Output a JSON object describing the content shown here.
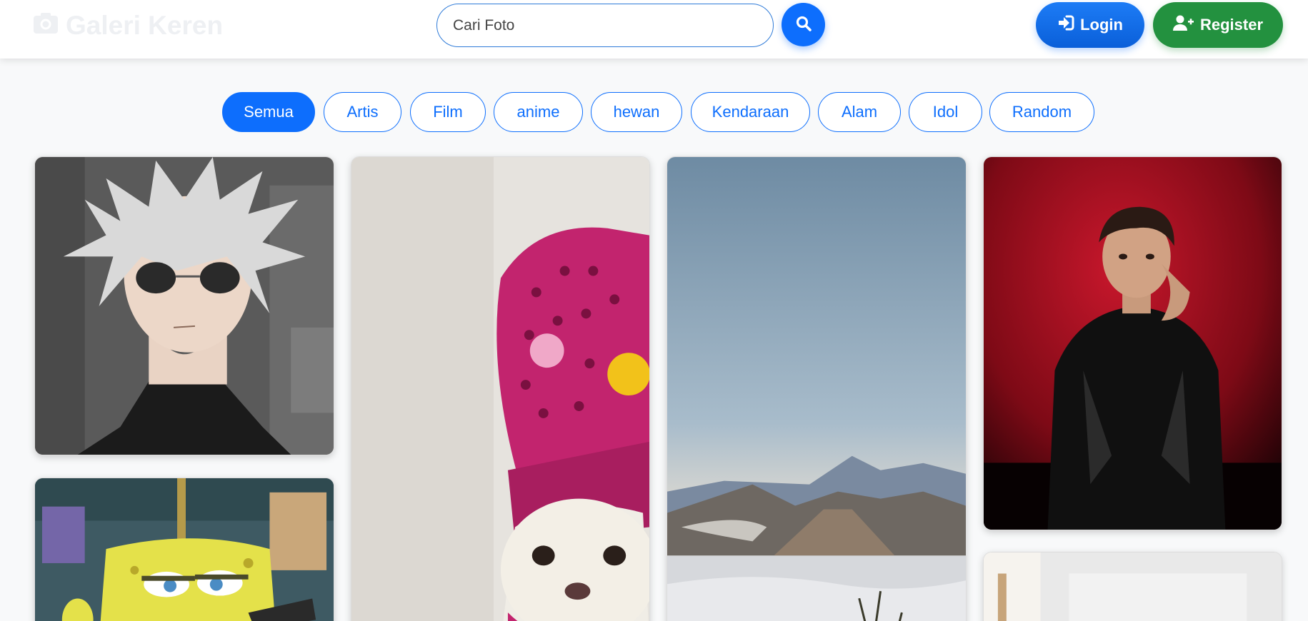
{
  "brand": {
    "title": "Galeri Keren",
    "icon": "camera-icon"
  },
  "search": {
    "placeholder": "Cari Foto",
    "button_icon": "search-icon"
  },
  "auth": {
    "login_label": "Login",
    "login_icon": "sign-in-icon",
    "register_label": "Register",
    "register_icon": "user-plus-icon"
  },
  "categories": [
    {
      "label": "Semua",
      "active": true
    },
    {
      "label": "Artis",
      "active": false
    },
    {
      "label": "Film",
      "active": false
    },
    {
      "label": "anime",
      "active": false
    },
    {
      "label": "hewan",
      "active": false
    },
    {
      "label": "Kendaraan",
      "active": false
    },
    {
      "label": "Alam",
      "active": false
    },
    {
      "label": "Idol",
      "active": false
    },
    {
      "label": "Random",
      "active": false
    }
  ],
  "gallery": [
    {
      "subject": "anime character with white hair and sunglasses"
    },
    {
      "subject": "cartoon sponge character"
    },
    {
      "subject": "chihuahua wearing pink clog hat"
    },
    {
      "subject": "volcano mountains above sea of clouds"
    },
    {
      "subject": "man in black leather jacket on red background"
    },
    {
      "subject": "portrait photo"
    }
  ],
  "colors": {
    "primary": "#0d6efd",
    "success": "#23913f",
    "background": "#f8f9fa"
  }
}
